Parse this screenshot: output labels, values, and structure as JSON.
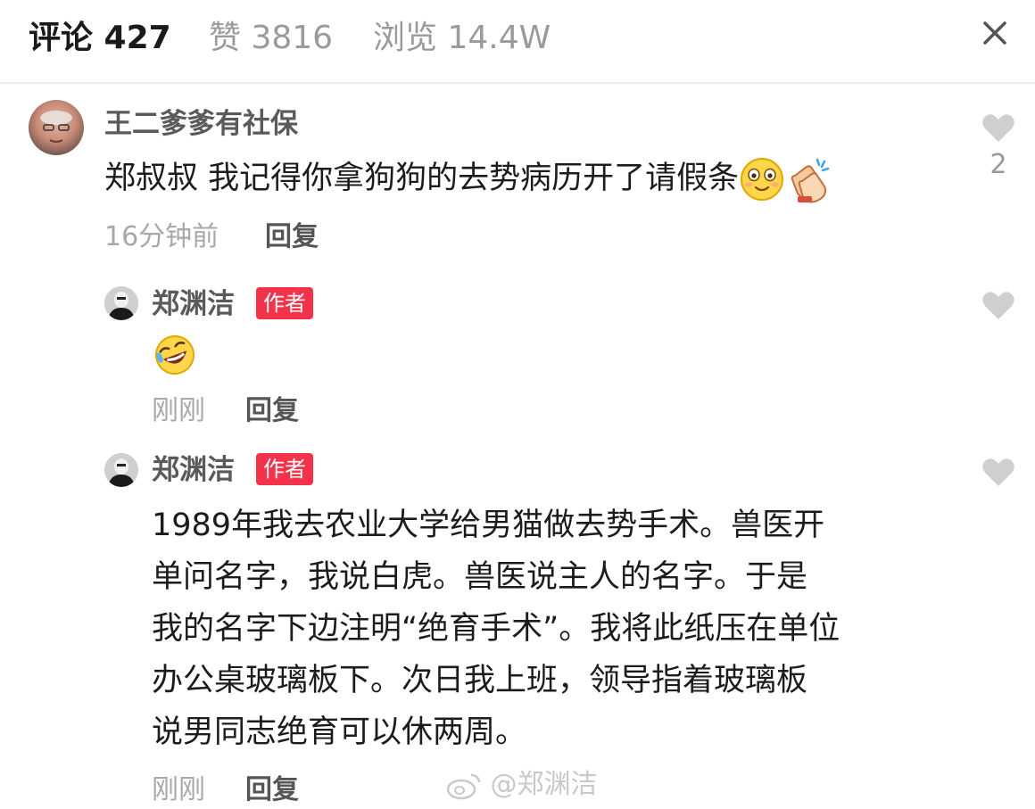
{
  "tabs": [
    {
      "label": "评论 427"
    },
    {
      "label": "赞 3816"
    },
    {
      "label": "浏览 14.4W"
    }
  ],
  "icons": {
    "close": "close-icon",
    "like": "heart-icon"
  },
  "colors": {
    "author_badge": "#f4324a",
    "heart": "#cfcfcf",
    "muted_text": "#a8a8a8"
  },
  "comment": {
    "user": "王二爹爹有社保",
    "text": "郑叔叔 我记得你拿狗狗的去势病历开了请假条",
    "emojis": [
      "smiling-face-emoji",
      "clapping-hands-emoji"
    ],
    "time": "16分钟前",
    "reply_label": "回复",
    "like_count": "2"
  },
  "replies": [
    {
      "user": "郑渊洁",
      "badge": "作者",
      "emoji": "rolling-on-floor-laughing-emoji",
      "time": "刚刚",
      "reply_label": "回复"
    },
    {
      "user": "郑渊洁",
      "badge": "作者",
      "lines": [
        "1989年我去农业大学给男猫做去势手术。兽医开",
        "单问名字，我说白虎。兽医说主人的名字。于是",
        "我的名字下边注明“绝育手术”。我将此纸压在单位",
        "办公桌玻璃板下。次日我上班，领导指着玻璃板",
        "说男同志绝育可以休两周。"
      ],
      "time": "刚刚",
      "reply_label": "回复"
    }
  ],
  "watermark": "@郑渊洁"
}
